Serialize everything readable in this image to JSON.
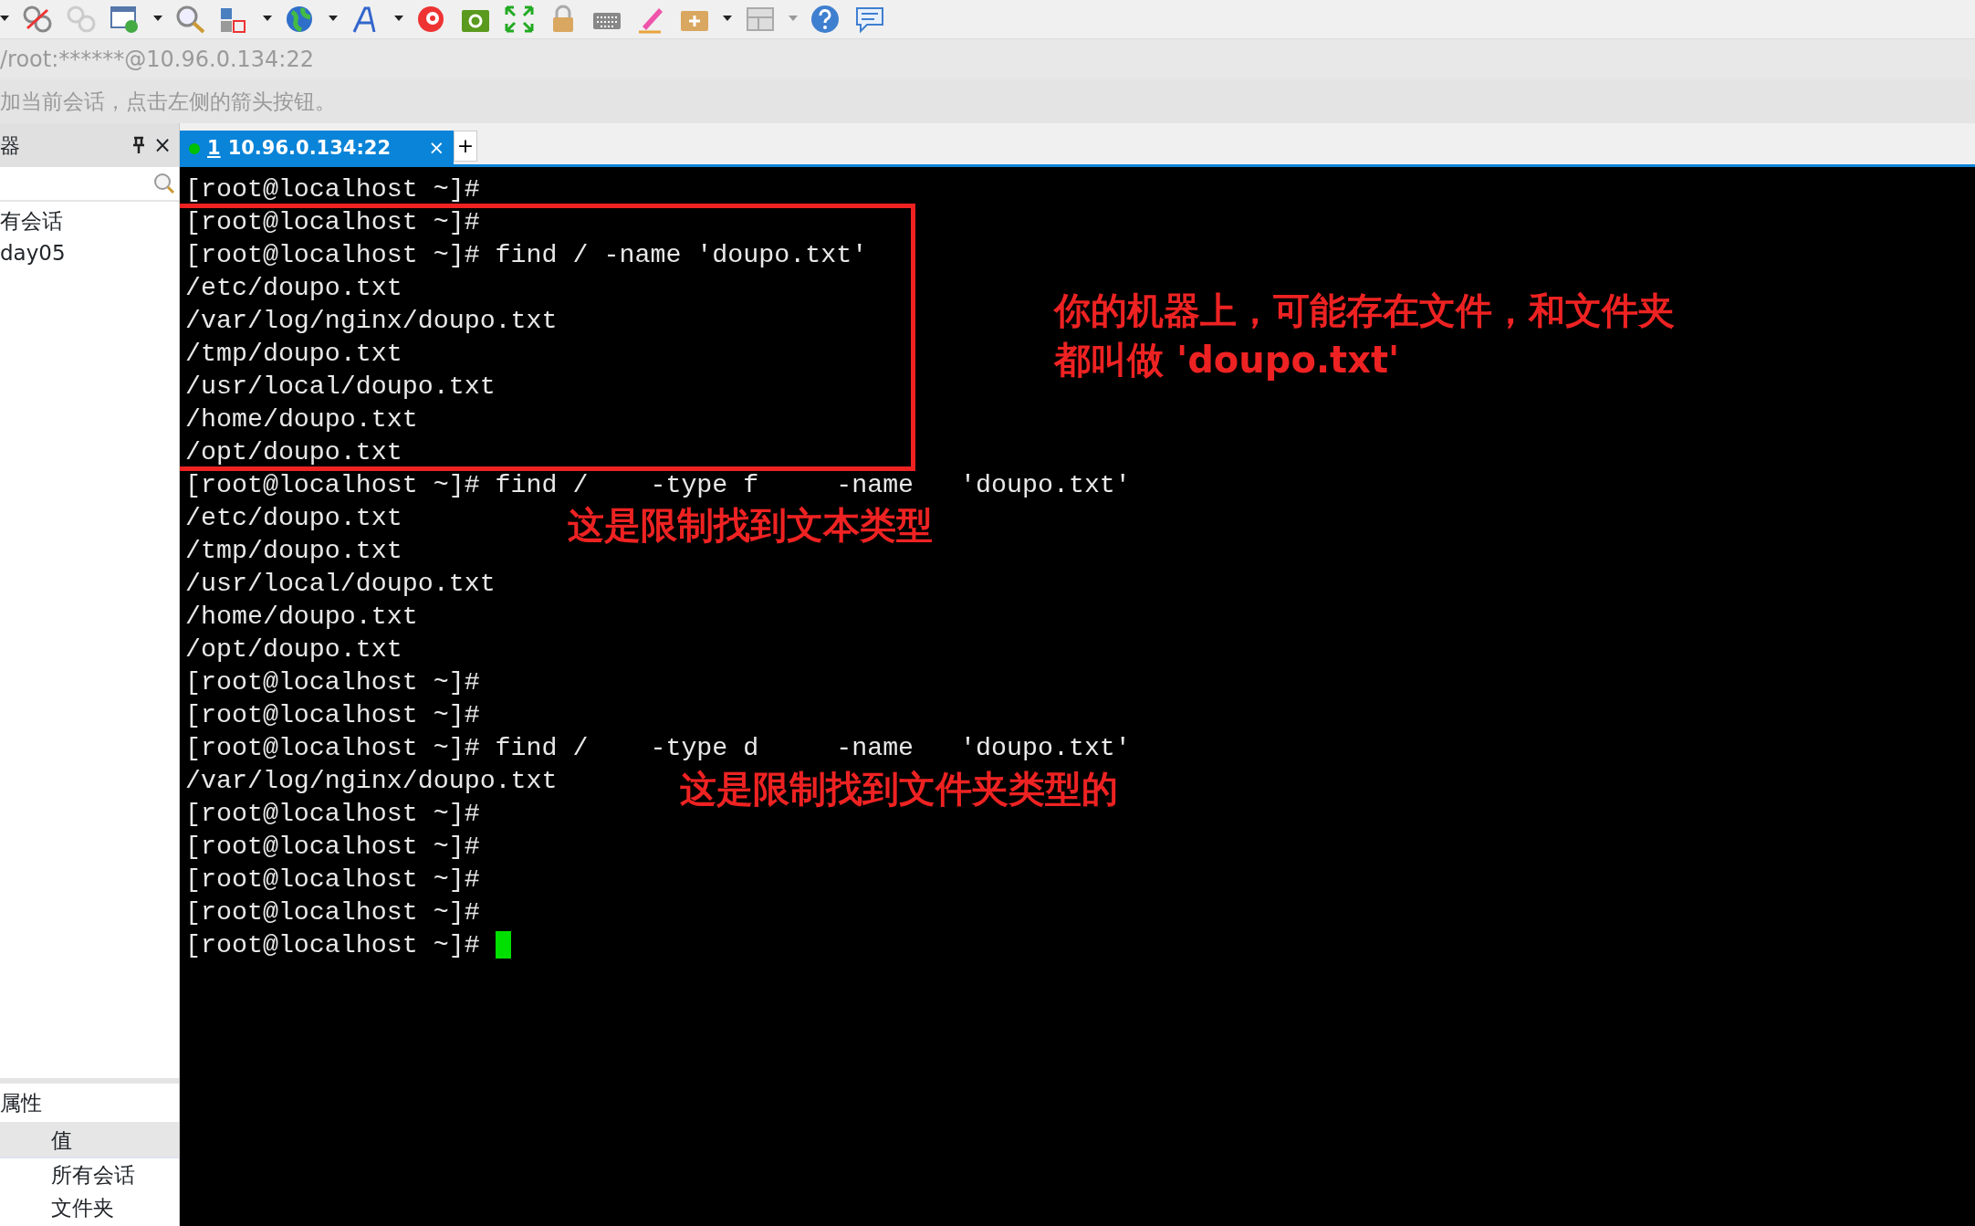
{
  "address_bar": {
    "value": "/root:******@10.96.0.134:22"
  },
  "hint_bar": {
    "text": "加当前会话，点击左侧的箭头按钮。"
  },
  "sidebar": {
    "title": "器",
    "close": "×",
    "items": [
      {
        "label": "有会话"
      },
      {
        "label": "day05"
      }
    ]
  },
  "properties": {
    "title": "属性",
    "columns": [
      "值"
    ],
    "rows": [
      {
        "value": "所有会话"
      },
      {
        "value": "文件夹"
      }
    ]
  },
  "tabs": [
    {
      "number": "1",
      "label": "10.96.0.134:22",
      "close": "×",
      "selected": true,
      "color": "#00c000"
    }
  ],
  "new_tab": "+",
  "terminal": {
    "cursor": true,
    "lines": [
      "[root@localhost ~]#",
      "[root@localhost ~]#",
      "[root@localhost ~]# find / -name 'doupo.txt'",
      "/etc/doupo.txt",
      "/var/log/nginx/doupo.txt",
      "/tmp/doupo.txt",
      "/usr/local/doupo.txt",
      "/home/doupo.txt",
      "/opt/doupo.txt",
      "[root@localhost ~]# find /    -type f     -name   'doupo.txt'",
      "/etc/doupo.txt",
      "/tmp/doupo.txt",
      "/usr/local/doupo.txt",
      "/home/doupo.txt",
      "/opt/doupo.txt",
      "[root@localhost ~]#",
      "[root@localhost ~]#",
      "[root@localhost ~]# find /    -type d     -name   'doupo.txt'",
      "/var/log/nginx/doupo.txt",
      "[root@localhost ~]#",
      "[root@localhost ~]#",
      "[root@localhost ~]#",
      "[root@localhost ~]#",
      "[root@localhost ~]# "
    ]
  },
  "annotations": [
    {
      "lines": [
        "你的机器上，可能存在文件，和文件夹",
        "都叫做 'doupo.txt'"
      ]
    },
    {
      "lines": [
        "这是限制找到文本类型"
      ]
    },
    {
      "lines": [
        "这是限制找到文件夹类型的"
      ]
    }
  ]
}
